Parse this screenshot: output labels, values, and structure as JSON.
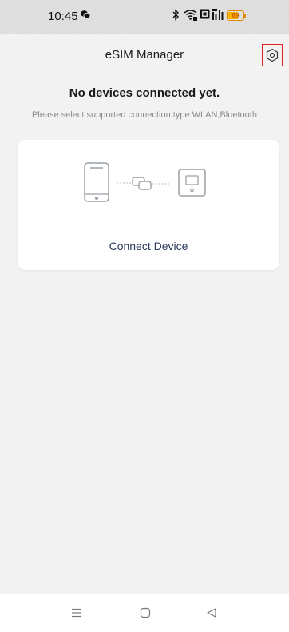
{
  "status_bar": {
    "time": "10:45",
    "battery_text": "69",
    "battery_level": 0.69,
    "icons": [
      "wechat-icon",
      "bluetooth-icon",
      "wifi-icon",
      "nfc-icon",
      "signal-icon",
      "battery-icon"
    ]
  },
  "header": {
    "title": "eSIM Manager",
    "settings_icon": "gear-icon"
  },
  "empty_state": {
    "title": "No devices connected yet.",
    "subtitle": "Please select supported connection type:WLAN,Bluetooth"
  },
  "card": {
    "connect_label": "Connect Device",
    "illustration_icons": [
      "phone-icon",
      "link-icon",
      "router-icon"
    ]
  },
  "nav_bar": {
    "icons": [
      "menu-icon",
      "home-icon",
      "back-icon"
    ]
  },
  "colors": {
    "background": "#f2f2f2",
    "card": "#ffffff",
    "highlight_border": "#e02020",
    "battery": "#ffb300",
    "connect_text": "#2b3a5c"
  }
}
